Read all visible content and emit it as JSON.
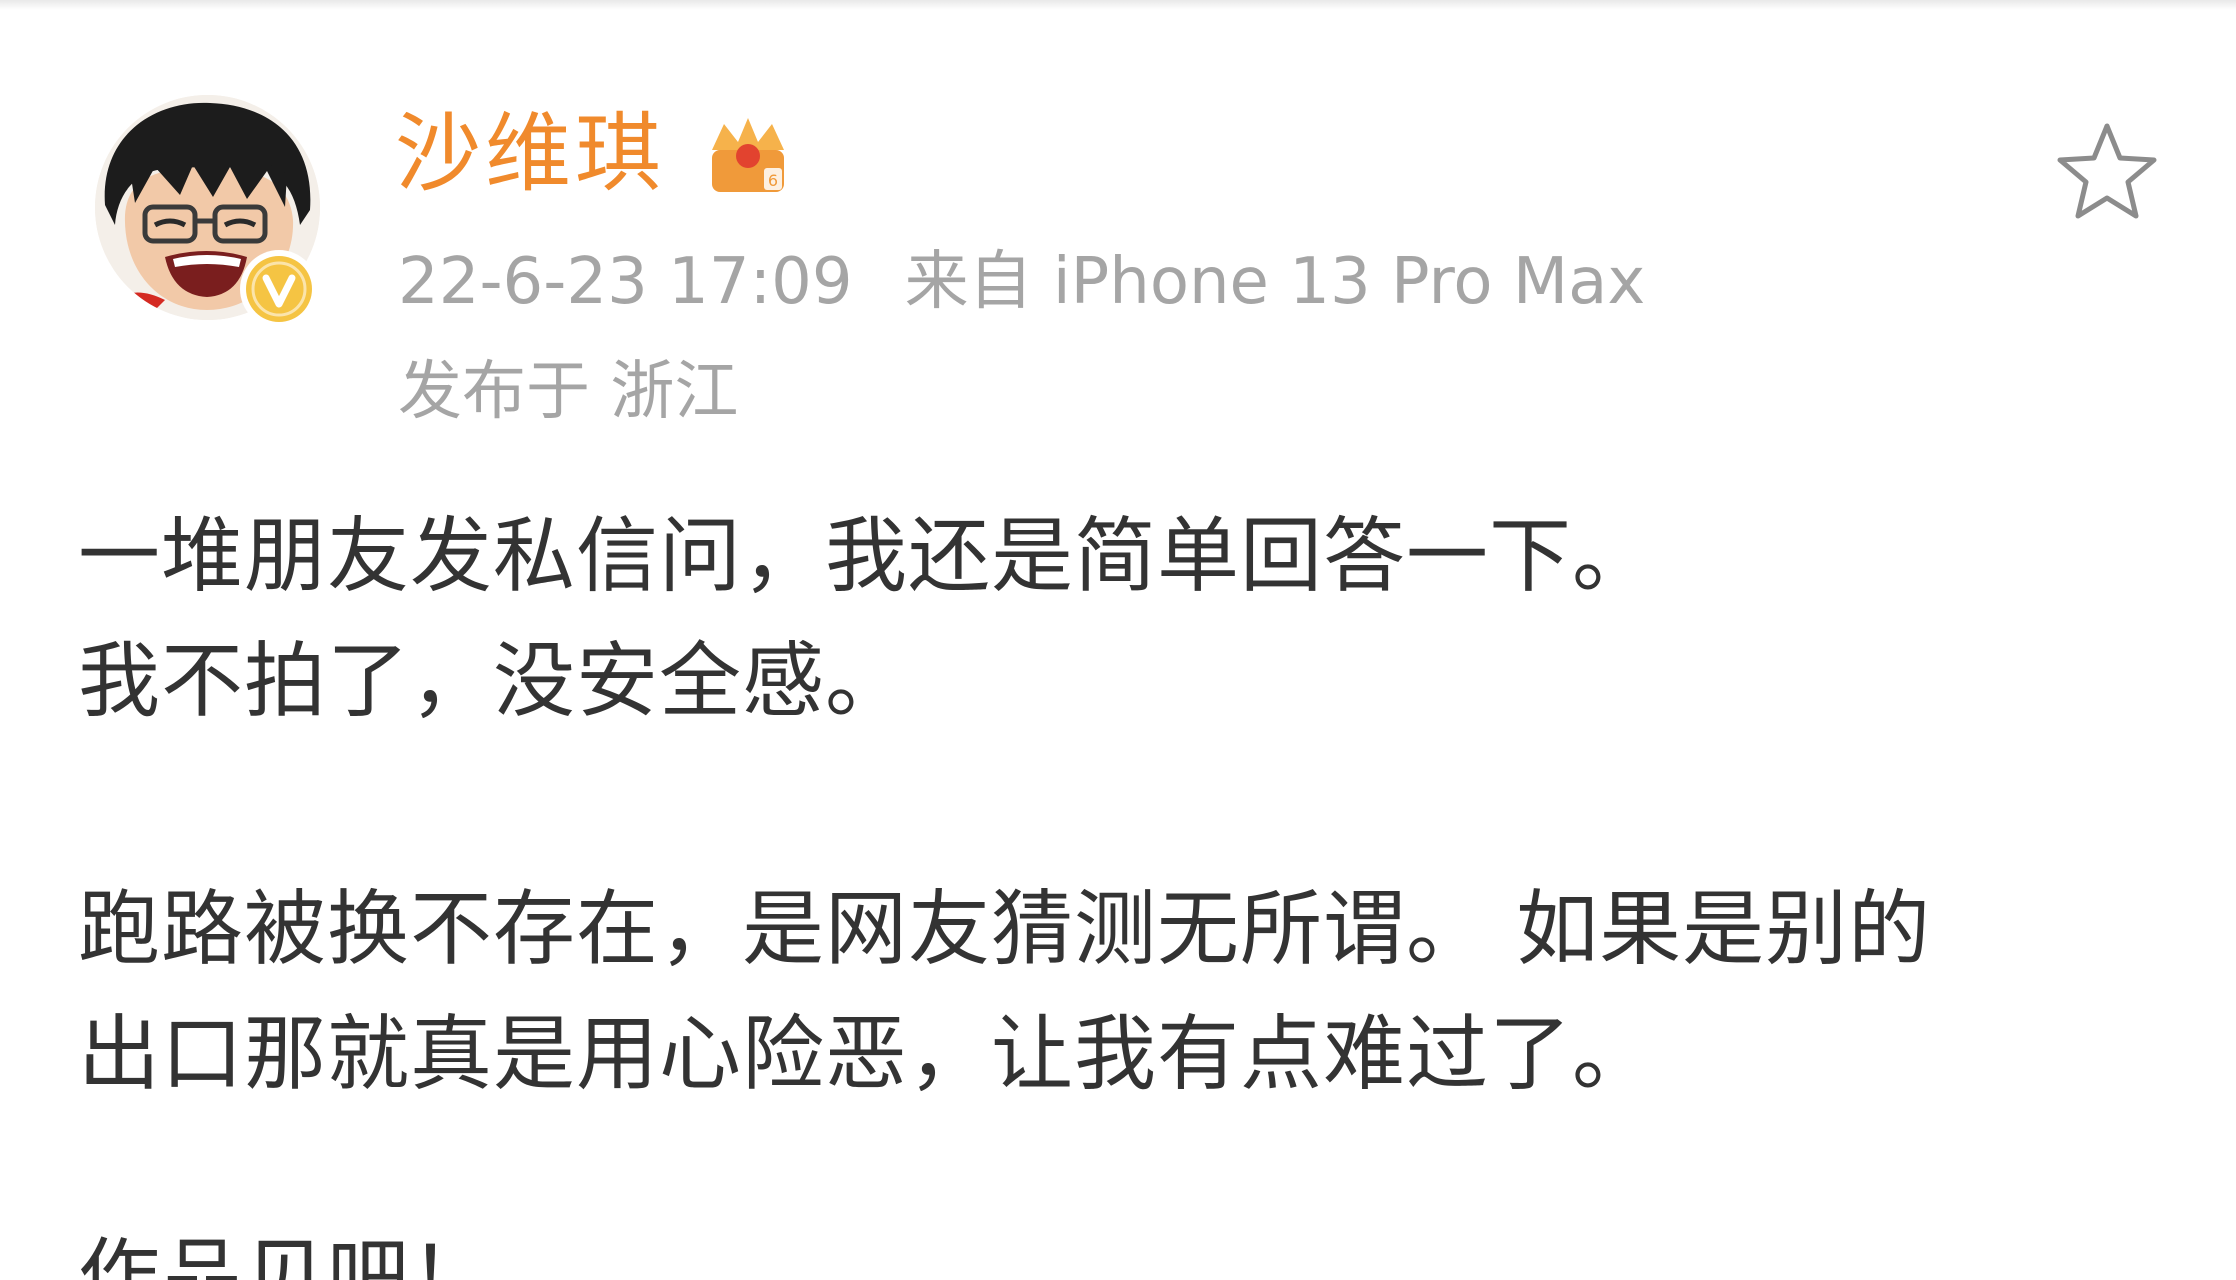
{
  "post": {
    "author": "沙维琪",
    "date": "22-6-23 17:09",
    "source": "来自 iPhone 13 Pro Max",
    "location": "发布于 浙江",
    "lines": [
      "一堆朋友发私信问，我还是简单回答一下。",
      "我不拍了，没安全感。",
      "跑路被换不存在，是网友猜测无所谓。 如果是别的",
      "出口那就真是用心险恶，让我有点难过了。",
      "作品见吧！"
    ]
  },
  "colors": {
    "username": "#f08a2c",
    "meta": "#a5a5a5",
    "body_text": "#333333",
    "verified_badge": "#f5c443"
  },
  "icons": {
    "favorite": "star-outline-icon",
    "verified": "verified-v-icon",
    "vip": "vip-crown-icon"
  }
}
